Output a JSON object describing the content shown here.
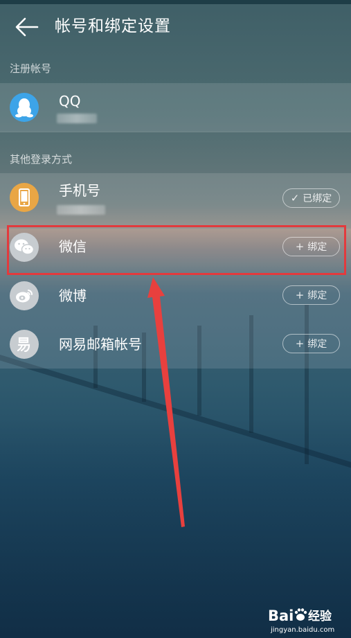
{
  "header": {
    "title": "帐号和绑定设置"
  },
  "sections": {
    "registered_label": "注册帐号",
    "other_label": "其他登录方式"
  },
  "registered_account": {
    "name": "QQ"
  },
  "other_logins": [
    {
      "label": "手机号",
      "status_label": "已绑定",
      "status_symbol": "✓"
    },
    {
      "label": "微信",
      "status_label": "绑定",
      "status_symbol": "+"
    },
    {
      "label": "微博",
      "status_label": "绑定",
      "status_symbol": "+"
    },
    {
      "label": "网易邮箱帐号",
      "status_label": "绑定",
      "status_symbol": "+"
    }
  ],
  "colors": {
    "qq_avatar": "#3da4e8",
    "phone_avatar": "#e9a645",
    "neutral_avatar": "#c7ccd0",
    "highlight_border": "#e33a3d",
    "arrow": "#e8403e"
  },
  "icons": {
    "back": "back-arrow-icon",
    "qq": "qq-penguin-icon",
    "phone": "phone-icon",
    "wechat": "wechat-icon",
    "weibo": "weibo-icon",
    "netease": "netease-mail-icon"
  },
  "watermark": {
    "brand": "Baidu",
    "label": "经验",
    "url": "jingyan.baidu.com"
  }
}
